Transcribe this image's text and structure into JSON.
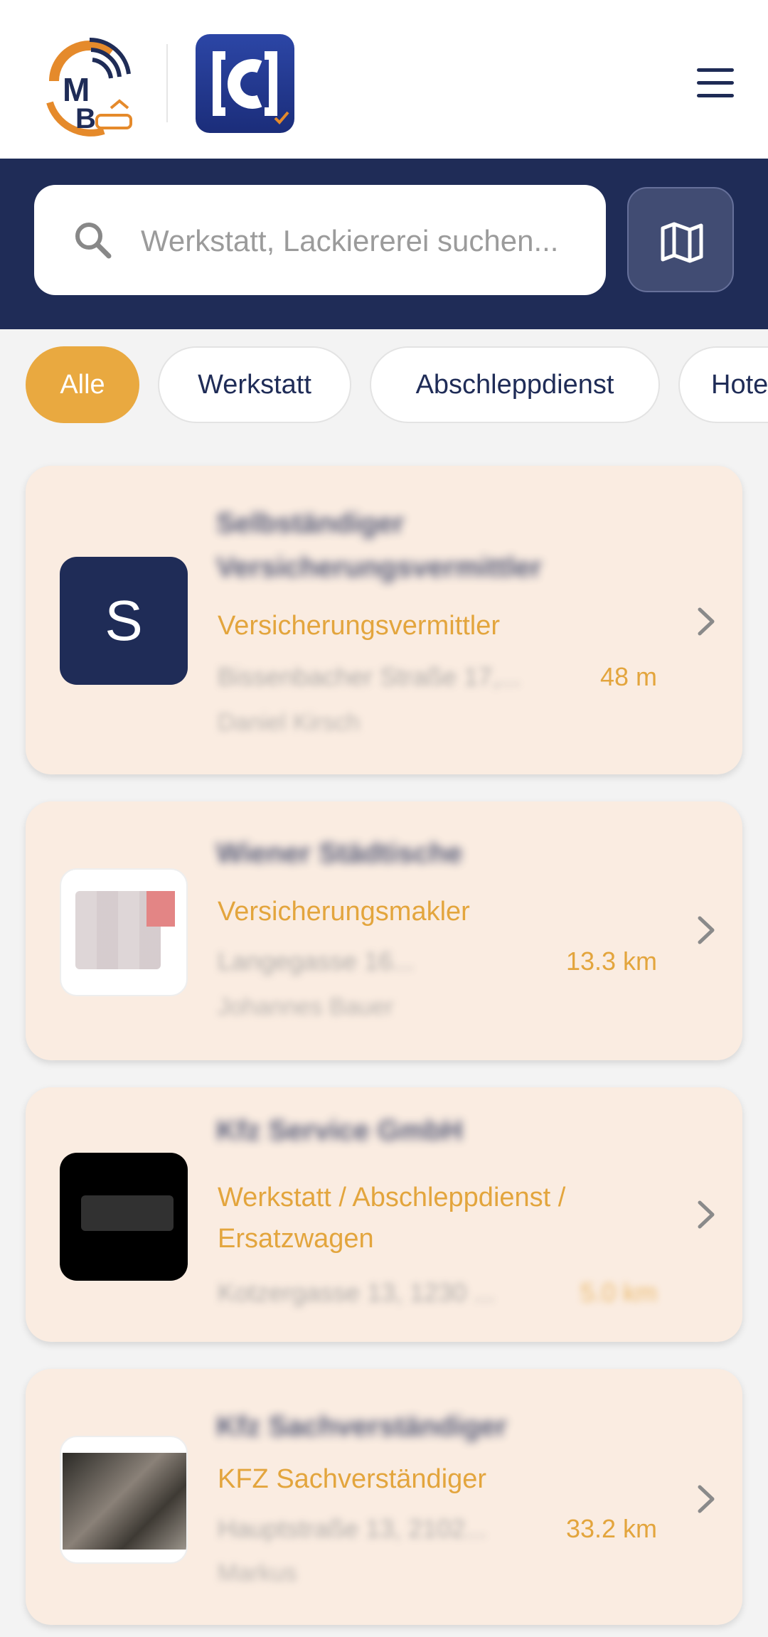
{
  "header": {
    "logo_mb_icon": "mb-logo-icon",
    "logo_c_icon": "c-app-logo-icon",
    "menu_icon": "hamburger-menu-icon"
  },
  "search": {
    "placeholder": "Werkstatt, Lackiererei suchen...",
    "value": "",
    "map_button_icon": "map-icon"
  },
  "filters": {
    "chips": [
      {
        "label": "Alle",
        "active": true
      },
      {
        "label": "Werkstatt",
        "active": false
      },
      {
        "label": "Abschleppdienst",
        "active": false
      },
      {
        "label": "Hote",
        "active": false
      }
    ]
  },
  "colors": {
    "navy": "#1f2c57",
    "accent": "#e9a940",
    "card_bg": "#faece1"
  },
  "results": [
    {
      "thumb_letter": "S",
      "title": "Selbständiger Versicherungsvermittler",
      "category": "Versicherungsvermittler",
      "address": "Bissenbacher Straße 17,...",
      "distance": "48 m",
      "person": "Daniel Kirsch"
    },
    {
      "thumb_letter": "",
      "title": "Wiener Städtische",
      "category": "Versicherungsmakler",
      "address": "Langegasse 16...",
      "distance": "13.3 km",
      "person": "Johannes Bauer"
    },
    {
      "thumb_letter": "",
      "title": "Kfz Service GmbH",
      "category": "Werkstatt / Abschleppdienst / Ersatzwagen",
      "address": "Kotzergasse 13, 1230 ...",
      "distance": "5.0 km",
      "person": ""
    },
    {
      "thumb_letter": "",
      "title": "Kfz Sachverständiger",
      "category": "KFZ Sachverständiger",
      "address": "Hauptstraße 13, 2102...",
      "distance": "33.2 km",
      "person": "Markus"
    }
  ]
}
